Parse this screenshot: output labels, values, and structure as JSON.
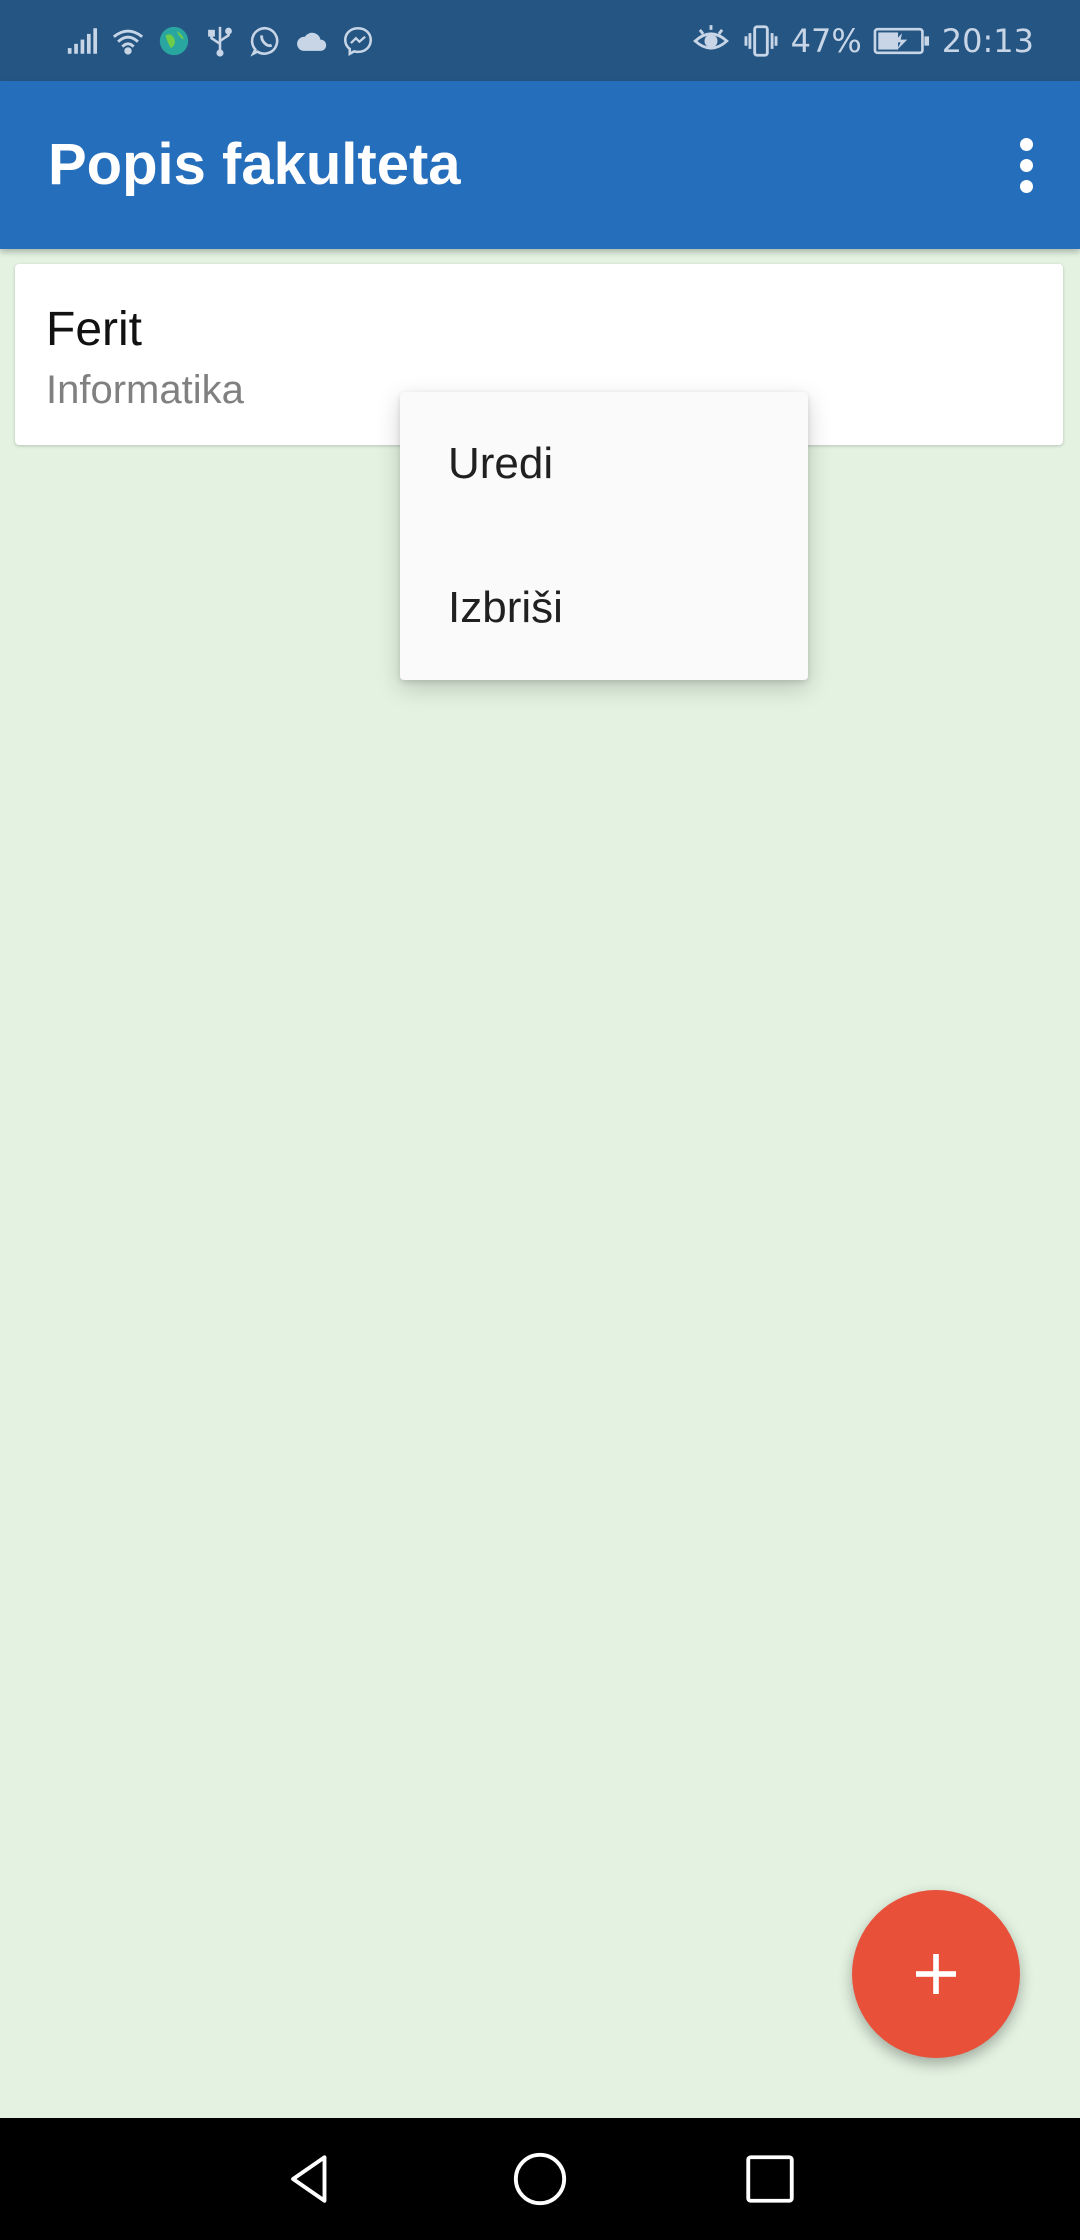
{
  "status_bar": {
    "battery_percent": "47%",
    "time": "20:13",
    "icons_left": [
      "signal-icon",
      "wifi-icon",
      "globe-icon",
      "usb-icon",
      "whatsapp-icon",
      "cloud-icon",
      "messenger-icon"
    ],
    "icons_right": [
      "eye-comfort-icon",
      "vibrate-icon",
      "battery-charging-icon"
    ]
  },
  "app_bar": {
    "title": "Popis fakulteta",
    "overflow_icon": "more-vert-icon",
    "color": "#256ebb"
  },
  "list": {
    "items": [
      {
        "title": "Ferit",
        "subtitle": "Informatika"
      }
    ]
  },
  "context_menu": {
    "items": [
      {
        "label": "Uredi"
      },
      {
        "label": "Izbriši"
      }
    ]
  },
  "fab": {
    "icon": "plus-icon",
    "color": "#e8503a"
  },
  "nav_bar": {
    "icons": [
      "back-icon",
      "home-icon",
      "recents-icon"
    ]
  },
  "colors": {
    "status_bar": "#255683",
    "background": "#e3f2e1"
  }
}
